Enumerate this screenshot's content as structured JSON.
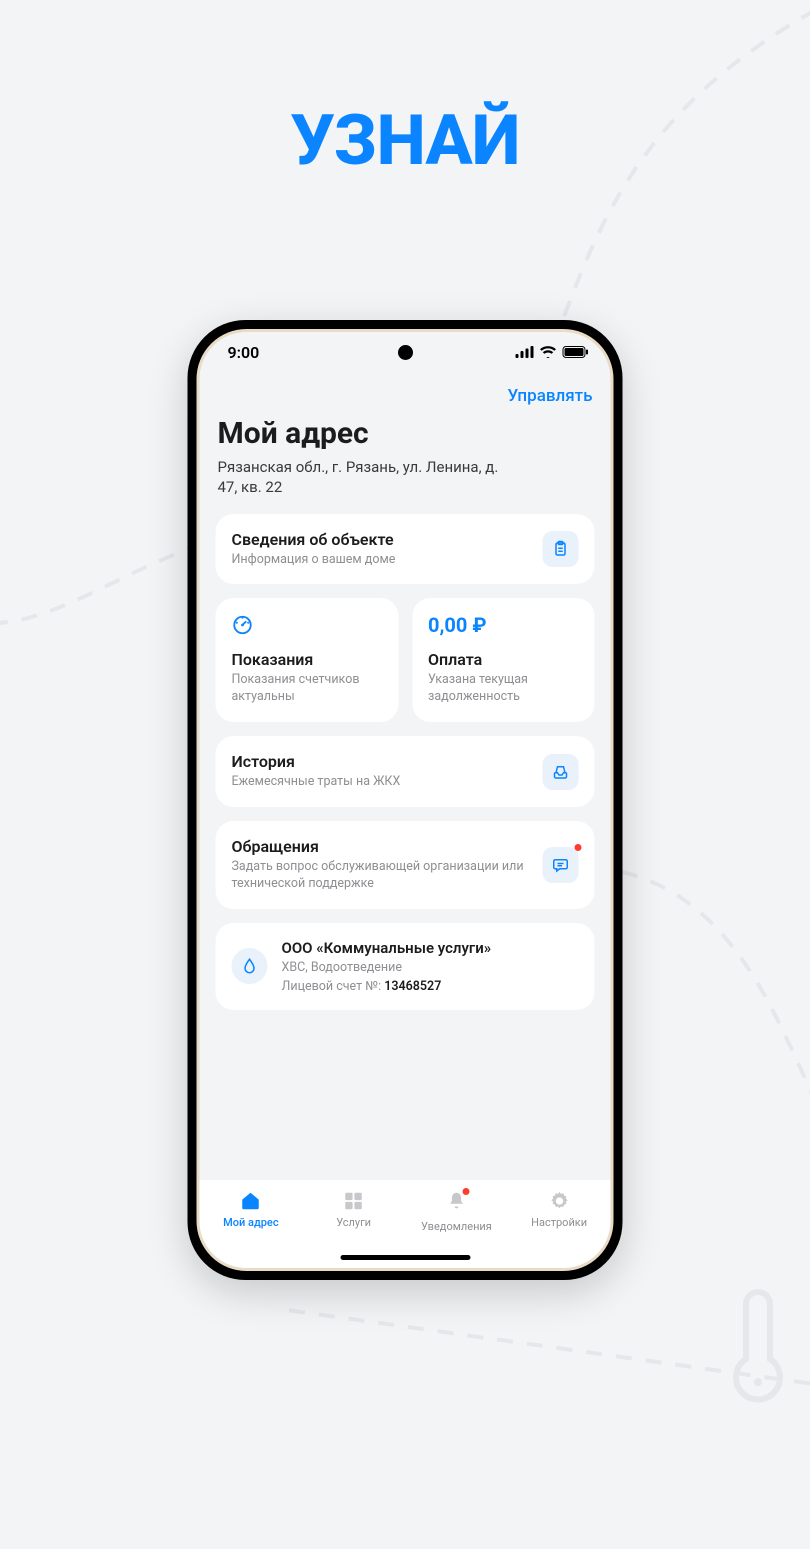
{
  "colors": {
    "accent": "#0a84ff",
    "text": "#1c1c1e",
    "muted": "#8e8e93",
    "bg": "#f2f4f6",
    "card": "#ffffff",
    "red": "#ff3b30"
  },
  "marketing": {
    "headline": "УЗНАЙ"
  },
  "statusbar": {
    "time": "9:00"
  },
  "topbar": {
    "manage": "Управлять"
  },
  "header": {
    "title": "Мой адрес",
    "address": "Рязанская обл., г. Рязань, ул. Ленина, д. 47, кв. 22"
  },
  "cards": {
    "property": {
      "title": "Сведения об объекте",
      "subtitle": "Информация о вашем доме"
    },
    "readings": {
      "title": "Показания",
      "subtitle": "Показания счетчиков актуальны"
    },
    "payment": {
      "amount": "0,00 ₽",
      "title": "Оплата",
      "subtitle": "Указана текущая задолженность"
    },
    "history": {
      "title": "История",
      "subtitle": "Ежемесячные траты на ЖКХ"
    },
    "appeals": {
      "title": "Обращения",
      "subtitle": "Задать вопрос обслуживающей организации или технической поддержке"
    }
  },
  "provider": {
    "name": "ООО «Коммунальные услуги»",
    "services": "ХВС, Водоотведение",
    "account_label": "Лицевой счет №: ",
    "account_number": "13468527"
  },
  "tabs": {
    "address": "Мой адрес",
    "services": "Услуги",
    "notifications": "Уведомления",
    "settings": "Настройки"
  }
}
